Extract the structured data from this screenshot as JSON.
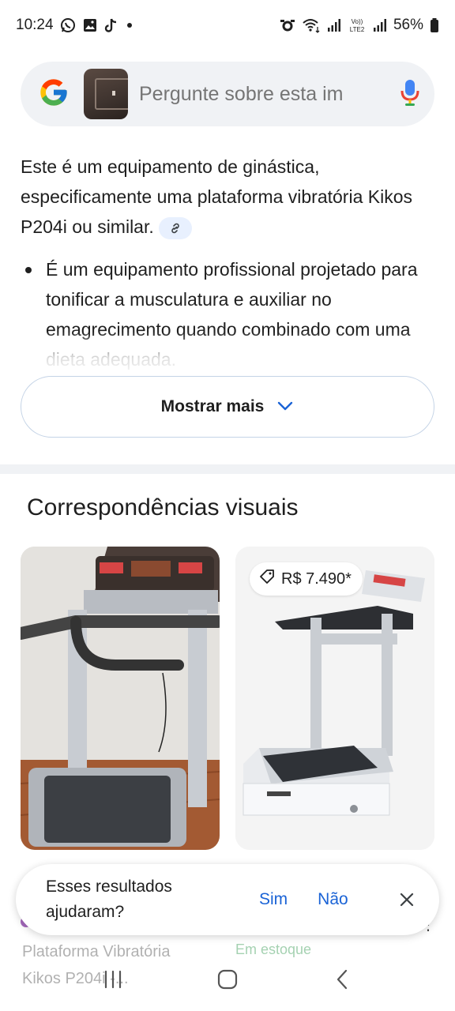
{
  "status_bar": {
    "time": "10:24",
    "left_icons": [
      "whatsapp-icon",
      "gallery-icon",
      "tiktok-icon",
      "dot-icon"
    ],
    "right_icons": [
      "alarm-icon",
      "wifi-icon",
      "signal-icon",
      "volte-icon",
      "signal-icon",
      "battery-icon"
    ],
    "volte_label": "VoLTE2",
    "battery": "56%"
  },
  "search": {
    "placeholder": "Pergunte sobre esta im",
    "logo": "google-g-icon",
    "mic": "mic-icon"
  },
  "answer": {
    "intro": "Este é um equipamento de ginástica, especificamente uma plataforma vibratória Kikos P204i ou similar.",
    "bullets": [
      "É um equipamento profissional projetado para tonificar a musculatura e auxiliar no emagrecimento quando combinado com uma dieta adequada."
    ],
    "show_more_label": "Mostrar mais"
  },
  "visual_matches": {
    "title": "Correspondências visuais",
    "cards": [
      {
        "title": "Plataforma Vibratória Kikos P204i -..."
      },
      {
        "price": "R$ 7.490*",
        "stock": "Em estoque"
      }
    ]
  },
  "feedback": {
    "question": "Esses resultados ajudaram?",
    "yes": "Sim",
    "no": "Não"
  },
  "colors": {
    "accent_blue": "#1a63d6",
    "search_bg": "#f0f2f5",
    "in_stock_green": "#1e8e3e"
  }
}
